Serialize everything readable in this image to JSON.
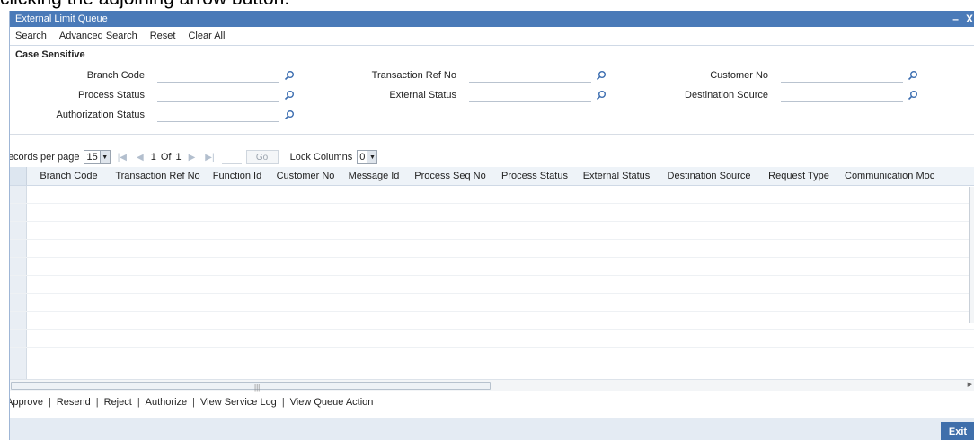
{
  "doc_text": "clicking the adjoining arrow button.",
  "window": {
    "title": "External Limit Queue",
    "minimize": "–",
    "close": "X"
  },
  "toolbar": {
    "items": [
      "Search",
      "Advanced Search",
      "Reset",
      "Clear All"
    ]
  },
  "section": {
    "title": "Case Sensitive"
  },
  "criteria": {
    "branch_code": "Branch Code",
    "process_status": "Process Status",
    "authorization_status": "Authorization Status",
    "transaction_ref_no": "Transaction Ref No",
    "external_status": "External Status",
    "customer_no": "Customer No",
    "destination_source": "Destination Source"
  },
  "pager": {
    "records_label": "Records per page",
    "records_value": "15",
    "page_current": "1",
    "of_label": "Of",
    "page_total": "1",
    "go_label": "Go",
    "lock_label": "Lock Columns",
    "lock_value": "0"
  },
  "grid": {
    "columns": [
      "Branch Code",
      "Transaction Ref No",
      "Function Id",
      "Customer No",
      "Message Id",
      "Process Seq No",
      "Process Status",
      "External Status",
      "Destination Source",
      "Request Type",
      "Communication Moc"
    ],
    "row_count": 13
  },
  "actions": [
    "Approve",
    "Resend",
    "Reject",
    "Authorize",
    "View Service Log",
    "View Queue Action"
  ],
  "footer": {
    "exit_label": "Exit"
  },
  "colors": {
    "title_bar": "#4a7ab8",
    "exit_button": "#3f6fab",
    "footer": "#e4ebf3"
  },
  "icons": {
    "lookup": "magnifier-icon"
  }
}
